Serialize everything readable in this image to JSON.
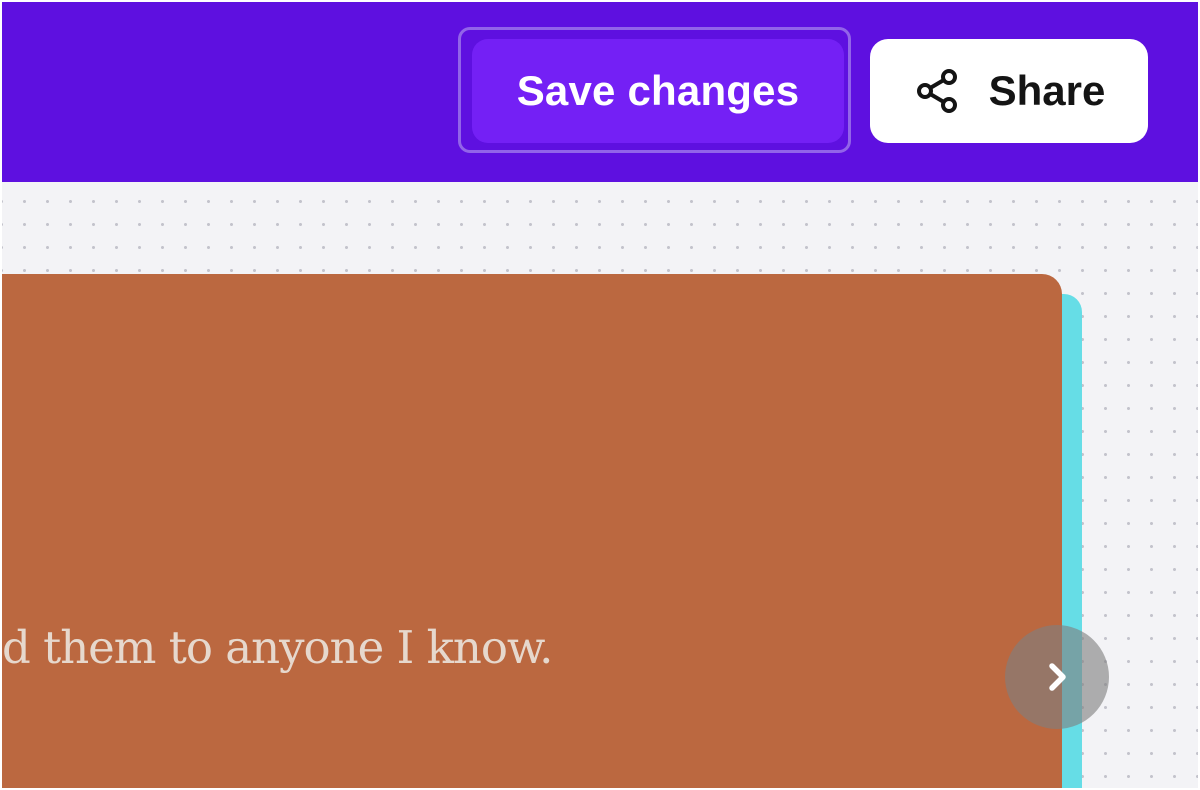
{
  "header": {
    "save_label": "Save changes",
    "share_label": "Share"
  },
  "slide": {
    "text": "d them to anyone I know."
  },
  "icons": {
    "share": "share-icon",
    "next": "chevron-right-icon"
  },
  "colors": {
    "header_bg": "#5e10e0",
    "save_button": "#7420f5",
    "share_button": "#ffffff",
    "card": "#bb6840",
    "card_shadow": "#66dde6",
    "canvas": "#f3f3f6"
  }
}
